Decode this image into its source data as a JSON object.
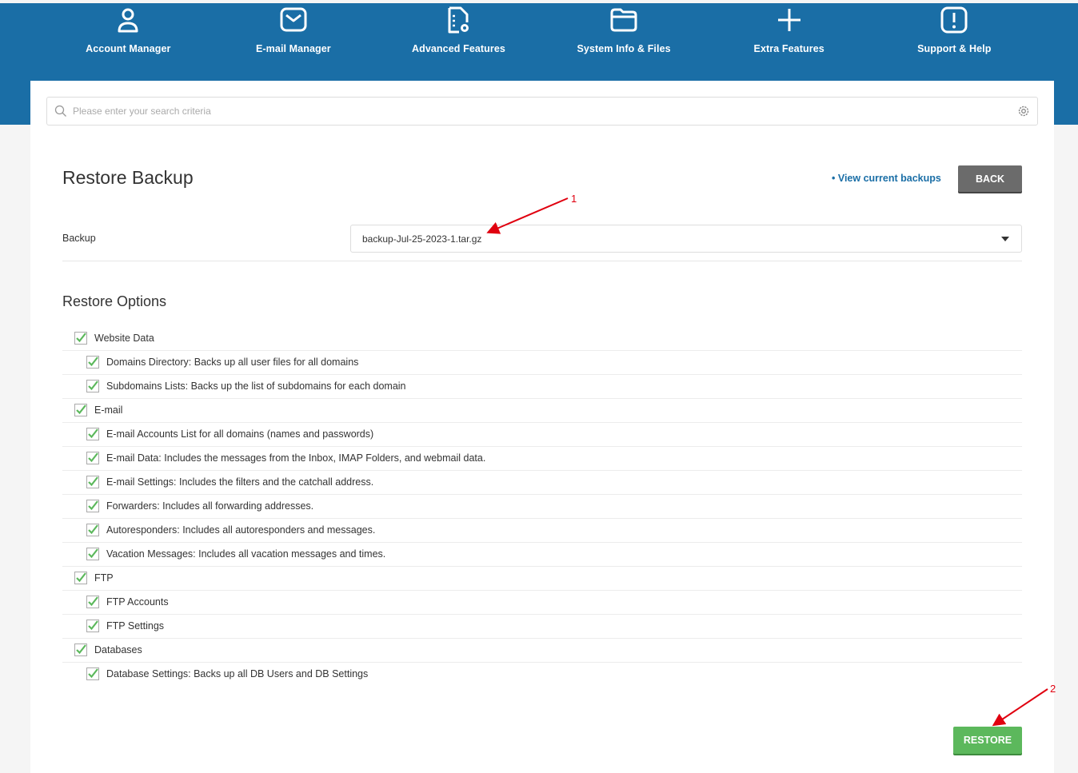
{
  "nav": {
    "items": [
      {
        "label": "Account Manager",
        "icon": "user-icon"
      },
      {
        "label": "E-mail Manager",
        "icon": "envelope-icon"
      },
      {
        "label": "Advanced Features",
        "icon": "file-gear-icon"
      },
      {
        "label": "System Info & Files",
        "icon": "folder-icon"
      },
      {
        "label": "Extra Features",
        "icon": "plus-icon"
      },
      {
        "label": "Support & Help",
        "icon": "exclamation-icon"
      }
    ]
  },
  "search": {
    "placeholder": "Please enter your search criteria"
  },
  "page": {
    "title": "Restore Backup",
    "view_link": "• View current backups",
    "back_label": "BACK"
  },
  "backup": {
    "label": "Backup",
    "selected": "backup-Jul-25-2023-1.tar.gz"
  },
  "options": {
    "title": "Restore Options",
    "groups": [
      {
        "label": "Website Data",
        "checked": true,
        "items": [
          {
            "label": "Domains Directory: Backs up all user files for all domains",
            "checked": true
          },
          {
            "label": "Subdomains Lists: Backs up the list of subdomains for each domain",
            "checked": true
          }
        ]
      },
      {
        "label": "E-mail",
        "checked": true,
        "items": [
          {
            "label": "E-mail Accounts List for all domains (names and passwords)",
            "checked": true
          },
          {
            "label": "E-mail Data: Includes the messages from the Inbox, IMAP Folders, and webmail data.",
            "checked": true
          },
          {
            "label": "E-mail Settings: Includes the filters and the catchall address.",
            "checked": true
          },
          {
            "label": "Forwarders: Includes all forwarding addresses.",
            "checked": true
          },
          {
            "label": "Autoresponders: Includes all autoresponders and messages.",
            "checked": true
          },
          {
            "label": "Vacation Messages: Includes all vacation messages and times.",
            "checked": true
          }
        ]
      },
      {
        "label": "FTP",
        "checked": true,
        "items": [
          {
            "label": "FTP Accounts",
            "checked": true
          },
          {
            "label": "FTP Settings",
            "checked": true
          }
        ]
      },
      {
        "label": "Databases",
        "checked": true,
        "items": [
          {
            "label": "Database Settings: Backs up all DB Users and DB Settings",
            "checked": true
          }
        ]
      }
    ]
  },
  "restore_label": "RESTORE",
  "annotations": [
    "1",
    "2"
  ],
  "colors": {
    "header": "#1a6ea6",
    "check": "#5cb85c",
    "annotation": "#e0000f"
  }
}
